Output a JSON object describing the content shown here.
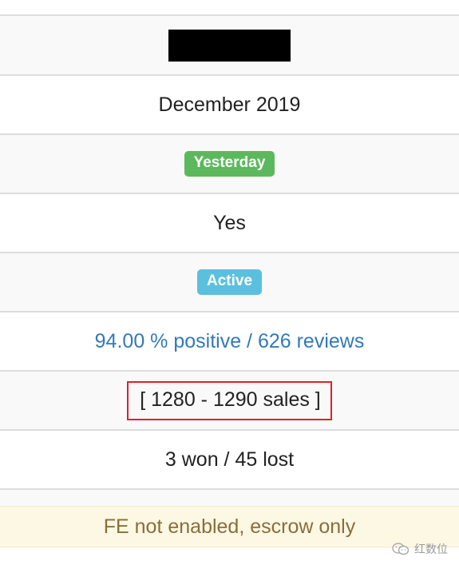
{
  "rows": {
    "member_since": "December 2019",
    "last_seen_badge": "Yesterday",
    "verified": "Yes",
    "status_badge": "Active",
    "feedback": "94.00 % positive / 626 reviews",
    "sales": "[ 1280 - 1290 sales ]",
    "disputes": "3 won / 45 lost"
  },
  "alert": {
    "text": "FE not enabled, escrow only"
  },
  "watermark": {
    "text": "红数位",
    "icon": "wechat-icon"
  },
  "colors": {
    "success": "#5cb85c",
    "info": "#5bc0de",
    "link": "#337ab7",
    "highlight_border": "#e0202a",
    "alert_bg": "#fcf8e3",
    "alert_text": "#8a6d3b"
  }
}
